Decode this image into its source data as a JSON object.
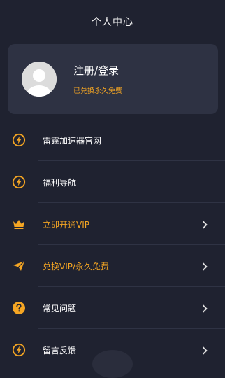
{
  "header": {
    "title": "个人中心"
  },
  "profile": {
    "login_label": "注册/登录",
    "vip_status": "已兑换永久免费"
  },
  "colors": {
    "background": "#1f2230",
    "card": "#2e3243",
    "accent": "#f5a623",
    "text": "#ffffff"
  },
  "menu": {
    "items": [
      {
        "label": "雷霆加速器官网",
        "icon": "lightning-icon",
        "accent": false,
        "chevron": false
      },
      {
        "label": "福利导航",
        "icon": "lightning-icon",
        "accent": false,
        "chevron": false
      },
      {
        "label": "立即开通VIP",
        "icon": "crown-icon",
        "accent": true,
        "chevron": true
      },
      {
        "label": "兑换VIP/永久免费",
        "icon": "paper-plane-icon",
        "accent": true,
        "chevron": true
      },
      {
        "label": "常见问题",
        "icon": "question-icon",
        "accent": false,
        "chevron": true
      },
      {
        "label": "留言反馈",
        "icon": "lightning-icon",
        "accent": false,
        "chevron": true
      }
    ]
  }
}
